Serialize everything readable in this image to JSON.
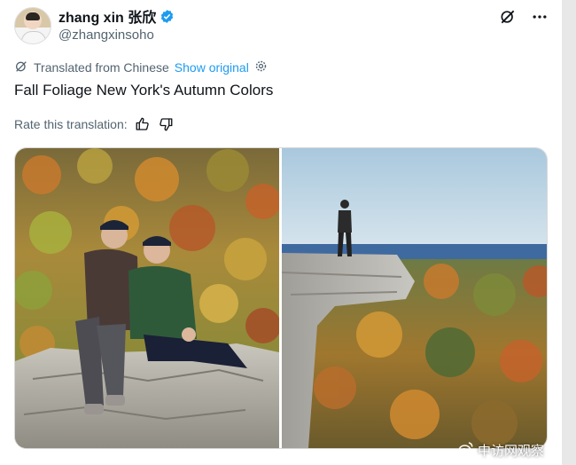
{
  "author": {
    "display_name": "zhang xin 张欣",
    "handle": "@zhangxinsoho",
    "verified": true
  },
  "header_icons": [
    "grok-icon",
    "more-icon"
  ],
  "translation": {
    "label": "Translated from Chinese",
    "show_original": "Show original"
  },
  "tweet": {
    "text": "Fall Foliage New York's Autumn Colors"
  },
  "rating": {
    "label": "Rate this translation:"
  },
  "media": {
    "watermark": "中访网观察"
  },
  "colors": {
    "link": "#1d9bf0",
    "verified": "#1d9bf0",
    "muted": "#536471"
  }
}
